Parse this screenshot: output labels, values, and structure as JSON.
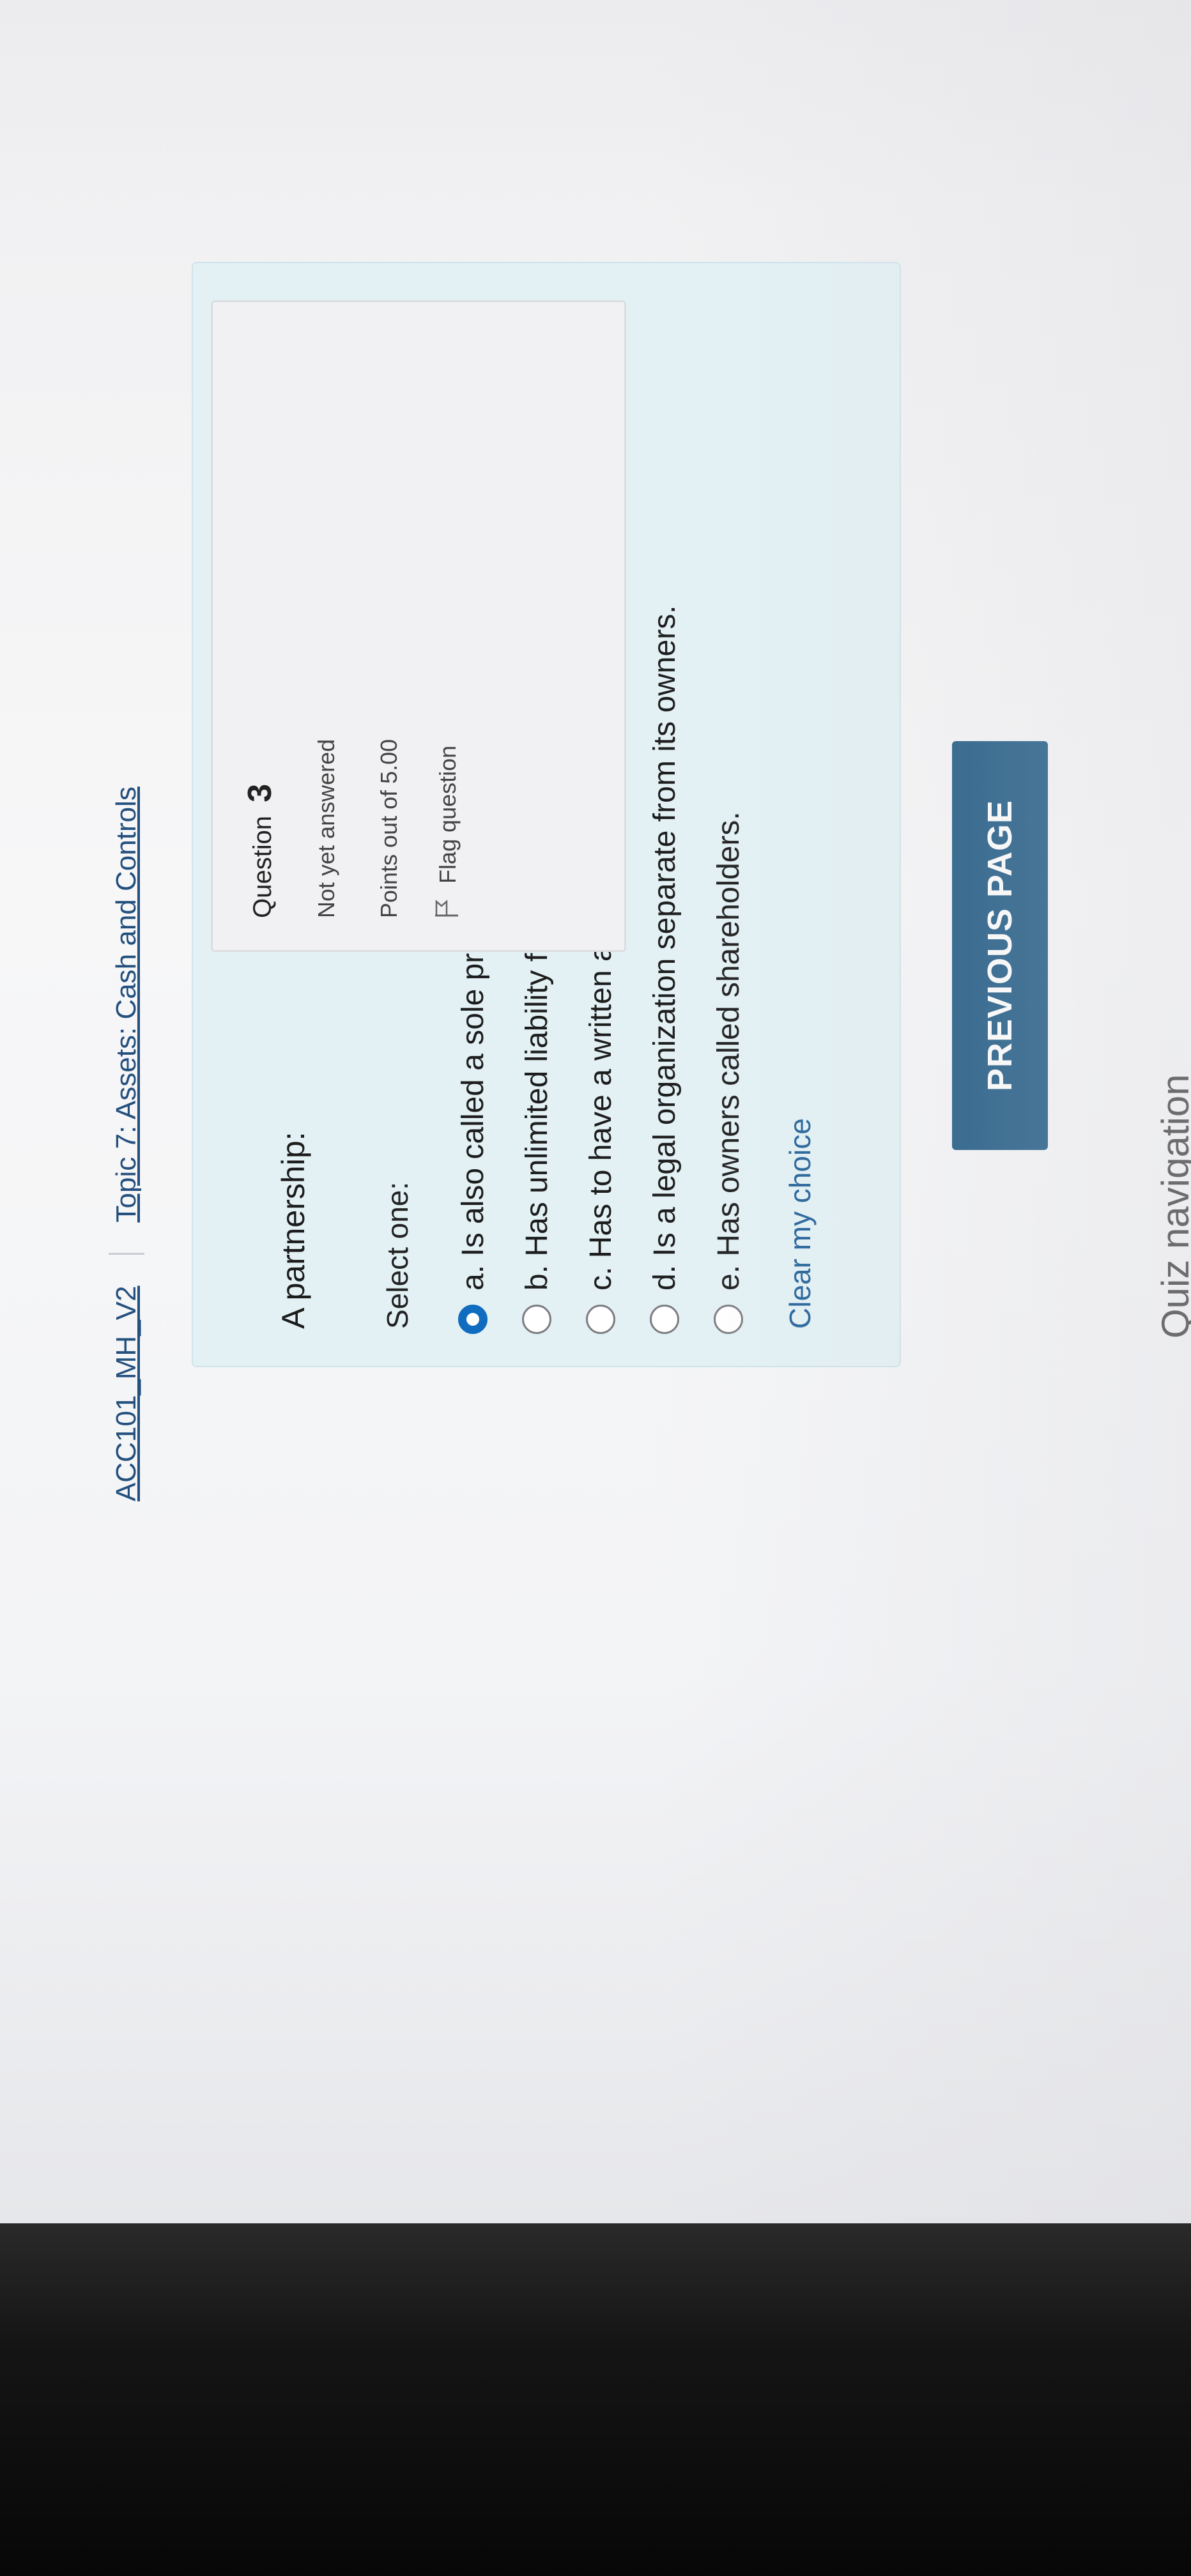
{
  "breadcrumb": {
    "course": "ACC101_MH_V2",
    "topic": "Topic 7: Assets: Cash and Controls"
  },
  "question_info": {
    "label": "Question",
    "number": "3",
    "state": "Not yet answered",
    "points": "Points out of 5.00",
    "flag_label": "Flag question"
  },
  "question": {
    "text": "A partnership:",
    "prompt": "Select one:",
    "answers": [
      {
        "label": "a. Is also called a sole proprietorship.",
        "selected": true
      },
      {
        "label": "b. Has unlimited liability for its partners.",
        "selected": false
      },
      {
        "label": "c. Has to have a written agreement in order to be legal.",
        "selected": false
      },
      {
        "label": "d. Is a legal organization separate from its owners.",
        "selected": false
      },
      {
        "label": "e. Has owners called shareholders.",
        "selected": false
      }
    ],
    "clear_label": "Clear my choice"
  },
  "navigation": {
    "previous_label": "PREVIOUS PAGE",
    "quiz_navigation_label": "Quiz navigation"
  },
  "colors": {
    "accent": "#0f6cbf",
    "button": "#14527e",
    "content_bg": "#e3f1f5",
    "link": "#24507e"
  }
}
